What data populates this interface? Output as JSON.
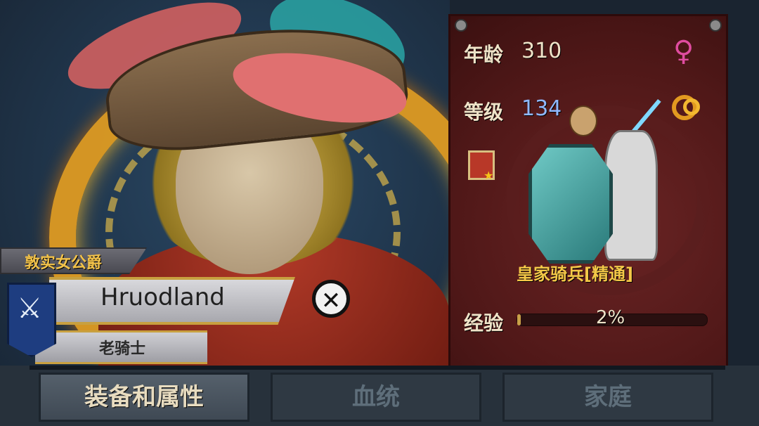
{
  "character": {
    "title": "敦实女公爵",
    "name": "Hruodland",
    "rank": "老骑士"
  },
  "stats": {
    "age_label": "年龄",
    "age_value": "310",
    "level_label": "等级",
    "level_value": "134",
    "exp_label": "经验",
    "exp_value": "2%",
    "exp_fraction": 0.02
  },
  "unit": {
    "name": "皇家骑兵[精通]"
  },
  "tabs": [
    {
      "label": "装备和属性",
      "active": true
    },
    {
      "label": "血统",
      "active": false
    },
    {
      "label": "家庭",
      "active": false
    }
  ],
  "icons": {
    "gender": "female-symbol-icon",
    "marriage": "wedding-rings-icon",
    "emblem": "sword-banner-icon",
    "close": "close-x-icon",
    "skill": "cavalry-skill-icon"
  },
  "colors": {
    "gold_text": "#f2c24a",
    "level_blue": "#8fb8ff",
    "female_pink": "#e04ca0",
    "panel_red": "#501818"
  }
}
